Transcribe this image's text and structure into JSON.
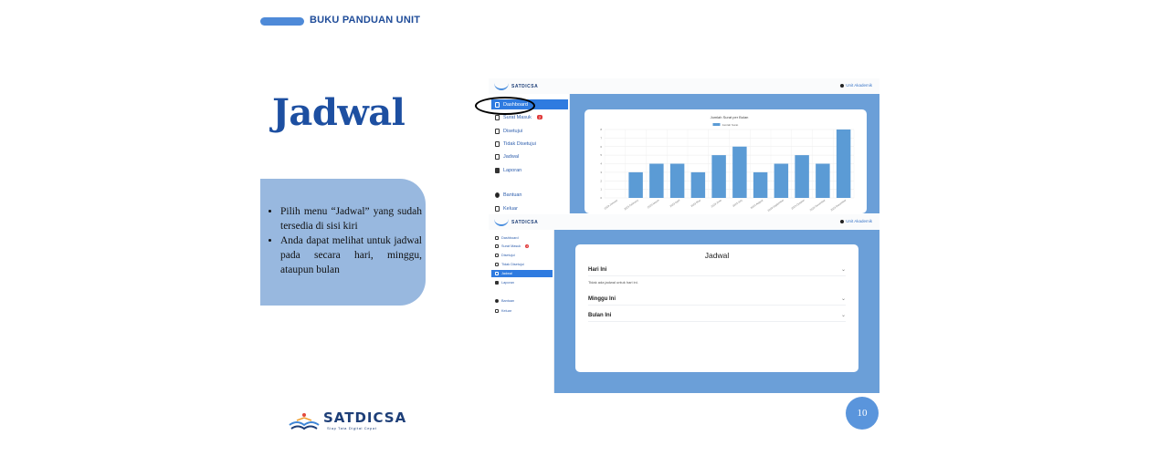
{
  "header": {
    "section_label": "BUKU PANDUAN UNIT"
  },
  "page_title": "Jadwal",
  "instructions": [
    "Pilih menu “Jadwal” yang sudah tersedia di sisi kiri",
    "Anda dapat melihat untuk jadwal pada secara hari, minggu, ataupun bulan"
  ],
  "screenshot_app": {
    "logo_text": "SATDICSA",
    "user_label": "Unit Akademik",
    "menu": [
      {
        "label": "Dashboard",
        "icon": "dashboard-icon"
      },
      {
        "label": "Surat Masuk",
        "icon": "mail-icon",
        "badge": "2"
      },
      {
        "label": "Disetujui",
        "icon": "file-check-icon"
      },
      {
        "label": "Tidak Disetujui",
        "icon": "file-x-icon"
      },
      {
        "label": "Jadwal",
        "icon": "calendar-icon"
      },
      {
        "label": "Laporan",
        "icon": "report-icon"
      },
      {
        "label": "Bantuan",
        "icon": "help-icon"
      },
      {
        "label": "Keluar",
        "icon": "logout-icon"
      }
    ],
    "chart_data": {
      "type": "bar",
      "title": "Jumlah Surat per Bulan",
      "legend": [
        "Jumlah Surat"
      ],
      "color": "#5b9bd5",
      "ylim": [
        0,
        8
      ],
      "yticks": [
        0,
        1,
        2,
        3,
        4,
        5,
        6,
        7,
        8
      ],
      "categories": [
        "2023-January",
        "2023-February",
        "2023-March",
        "2023-April",
        "2023-May",
        "2023-June",
        "2023-July",
        "2023-August",
        "2023-September",
        "2023-October",
        "2023-November",
        "2023-December"
      ],
      "values": [
        0,
        3,
        4,
        4,
        3,
        5,
        6,
        3,
        4,
        5,
        4,
        8
      ]
    },
    "schedule": {
      "title": "Jadwal",
      "sections": [
        {
          "label": "Hari Ini",
          "body": "Tidak ada jadwal untuk hari ini."
        },
        {
          "label": "Minggu Ini"
        },
        {
          "label": "Bulan Ini"
        }
      ]
    }
  },
  "footer": {
    "brand": "SATDICSA",
    "tagline": "Siap Tata Digital Cepat",
    "page_number": "10"
  }
}
